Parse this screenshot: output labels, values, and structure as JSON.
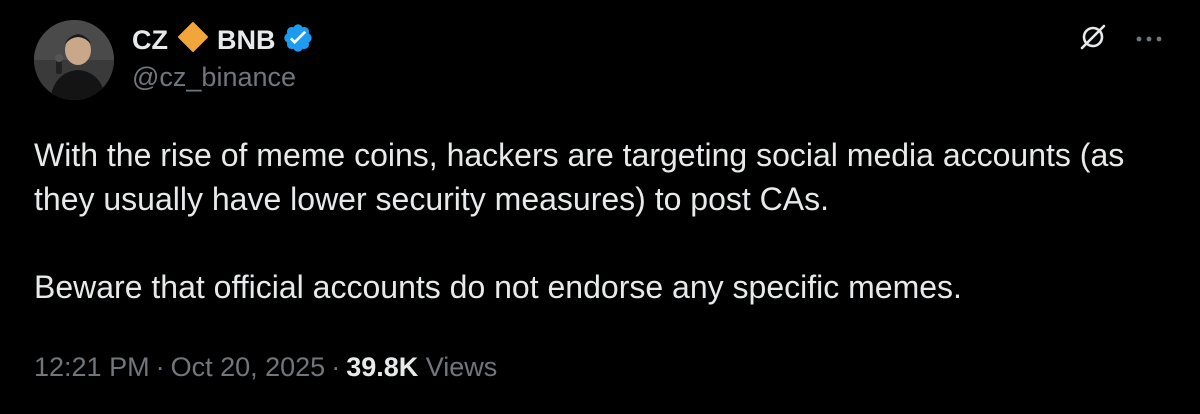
{
  "author": {
    "name": "CZ",
    "name_suffix": "BNB",
    "handle": "@cz_binance",
    "verified": true,
    "avatar_icon": "profile-photo-icon",
    "diamond_color": "#f0a63a",
    "badge_color": "#1d9bf0"
  },
  "tweet": {
    "paragraphs": [
      "With the rise of meme coins, hackers are targeting social media accounts (as they usually have lower security measures) to post CAs.",
      "Beware that official accounts do not endorse any specific memes."
    ]
  },
  "meta": {
    "time": "12:21 PM",
    "separator": "·",
    "date": "Oct 20, 2025",
    "views_count": "39.8K",
    "views_label": "Views"
  },
  "actions": {
    "grok_icon": "grok-icon",
    "more_icon": "more-icon"
  },
  "theme": {
    "background": "#000000",
    "text_primary": "#e7e9ea",
    "text_secondary": "#71767b"
  }
}
